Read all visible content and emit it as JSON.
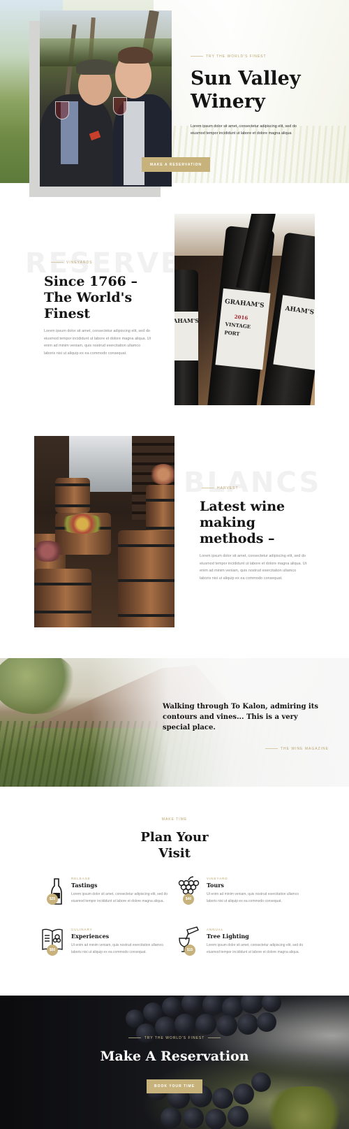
{
  "hero": {
    "eyebrow": "TRY THE WORLD'S FINEST",
    "title_line1": "Sun Valley",
    "title_line2": "Winery",
    "text": "Lorem ipsum dolor sit amet, consectetur adipiscing elit, sed do eiusmod tempor incididunt ut labore et dolore magna aliqua",
    "button": "MAKE A RESERVATION"
  },
  "section_reserve": {
    "watermark": "RESERVE",
    "eyebrow": "VINEYARDS",
    "title_line1": "Since 1766 –",
    "title_line2": "The World's",
    "title_line3": "Finest",
    "text": "Lorem ipsum dolor sit amet, consectetur adipiscing elit, sed do eiusmod tempor incididunt ut labore et dolore magna aliqua. Ut enim ad minim veniam, quis nostrud exercitation ullamco laboris nisi ut aliquip ex ea commodo consequat.",
    "bottle_labels": [
      "AHAM'S",
      "GRAHAM'S",
      "2016",
      "VINTAGE",
      "PORT",
      "AHAM'S"
    ]
  },
  "section_blancs": {
    "watermark": "BLANCS",
    "eyebrow": "HARVEST",
    "title_line1": "Latest wine",
    "title_line2": "making",
    "title_line3": "methods –",
    "text": "Lorem ipsum dolor sit amet, consectetur adipiscing elit, sed do eiusmod tempor incididunt ut labore et dolore magna aliqua. Ut enim ad minim veniam, quis nostrud exercitation ullamco laboris nisi ut aliquip ex ea commodo consequat."
  },
  "quote": {
    "text": "Walking through To Kalon, admiring its contours and vines... This is a very special place.",
    "source": "THE WINE MAGAZINE"
  },
  "plan": {
    "eyebrow": "MAKE TIME",
    "title_line1": "Plan Your",
    "title_line2": "Visit",
    "services": [
      {
        "eyebrow": "RELEASE",
        "title": "Tastings",
        "price": "$25",
        "icon": "wine-bottle-icon",
        "text": "Lorem ipsum dolor sit amet, consectetur adipiscing elit, sed do eiusmod tempor incididunt ut labore et dolore magna aliqua."
      },
      {
        "eyebrow": "VINEYARD",
        "title": "Tours",
        "price": "$40",
        "icon": "grapes-icon",
        "text": "Ut enim ad minim veniam, quis nostrud exercitation ullamco laboris nisi ut aliquip ex ea commodo consequat."
      },
      {
        "eyebrow": "CULINARY",
        "title": "Experiences",
        "price": "$50",
        "icon": "wine-menu-icon",
        "text": "Ut enim ad minim veniam, quis nostrud exercitation ullamco laboris nisi ut aliquip ex ea commodo consequat."
      },
      {
        "eyebrow": "ANNUAL",
        "title": "Tree Lighting",
        "price": "$15",
        "icon": "wine-pour-icon",
        "text": "Lorem ipsum dolor sit amet, consectetur adipiscing elit, sed do eiusmod tempor incididunt ut labore et dolore magna aliqua."
      }
    ]
  },
  "reservation": {
    "eyebrow": "TRY THE WORLD'S FINEST",
    "title": "Make A Reservation",
    "button": "BOOK YOUR TIME"
  },
  "colors": {
    "gold": "#c7b27c",
    "heading": "#141414",
    "body_text": "#8a8a8a"
  }
}
